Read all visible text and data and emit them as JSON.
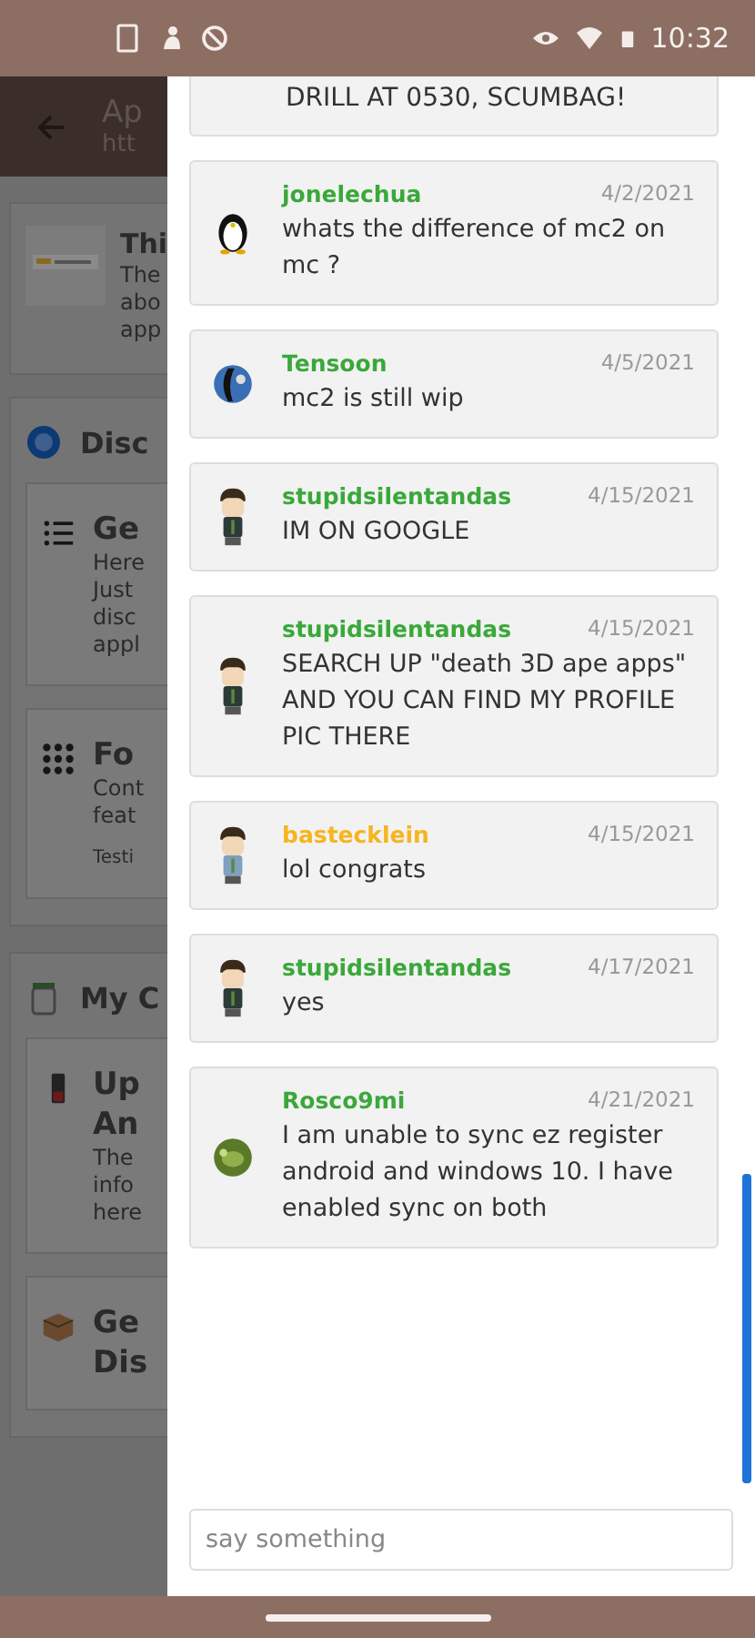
{
  "status_bar": {
    "time": "10:32"
  },
  "background": {
    "app_bar": {
      "title": "Ap",
      "subtitle": "htt"
    },
    "top_card": {
      "title": "Thi",
      "lines": [
        "The",
        "abo",
        "app"
      ]
    },
    "sections": [
      {
        "title": "Disc",
        "kind": "globe",
        "items": [
          {
            "kind": "list",
            "title": [
              "Ge"
            ],
            "lines": [
              "Here",
              "Just",
              "disc",
              "appl"
            ]
          },
          {
            "kind": "grid",
            "title": [
              "Fo"
            ],
            "lines": [
              "Cont",
              "feat"
            ],
            "tag": "Testi"
          }
        ]
      },
      {
        "title": "My C",
        "kind": "bin",
        "items": [
          {
            "kind": "phone",
            "title": [
              "Up",
              "An"
            ],
            "lines": [
              "The",
              "info",
              "here"
            ]
          },
          {
            "kind": "box",
            "title": [
              "Ge",
              "Dis"
            ]
          }
        ]
      }
    ]
  },
  "chat": {
    "top_partial": "DRILL AT 0530, SCUMBAG!",
    "messages": [
      {
        "kind": "penguin",
        "user": "jonelechua",
        "color": "#3aa83a",
        "date": "4/2/2021",
        "text": "whats the difference of mc2 on mc ?"
      },
      {
        "kind": "globe",
        "user": "Tensoon",
        "color": "#3aa83a",
        "date": "4/5/2021",
        "text": "mc2 is still wip"
      },
      {
        "kind": "boy",
        "user": "stupidsilentandas",
        "color": "#3aa83a",
        "date": "4/15/2021",
        "text": "IM ON GOOGLE"
      },
      {
        "kind": "boy",
        "user": "stupidsilentandas",
        "color": "#3aa83a",
        "date": "4/15/2021",
        "text": "SEARCH UP \"death 3D ape apps\" AND YOU CAN FIND MY PROFILE PIC THERE"
      },
      {
        "kind": "boy-blue",
        "user": "bastecklein",
        "color": "#f5b51e",
        "date": "4/15/2021",
        "text": "lol congrats"
      },
      {
        "kind": "boy",
        "user": "stupidsilentandas",
        "color": "#3aa83a",
        "date": "4/17/2021",
        "text": "yes"
      },
      {
        "kind": "turtle",
        "user": "Rosco9mi",
        "color": "#3aa83a",
        "date": "4/21/2021",
        "text": "I am unable to sync ez register android and windows 10. I have enabled sync on both"
      }
    ],
    "input": {
      "placeholder": "say something"
    }
  }
}
